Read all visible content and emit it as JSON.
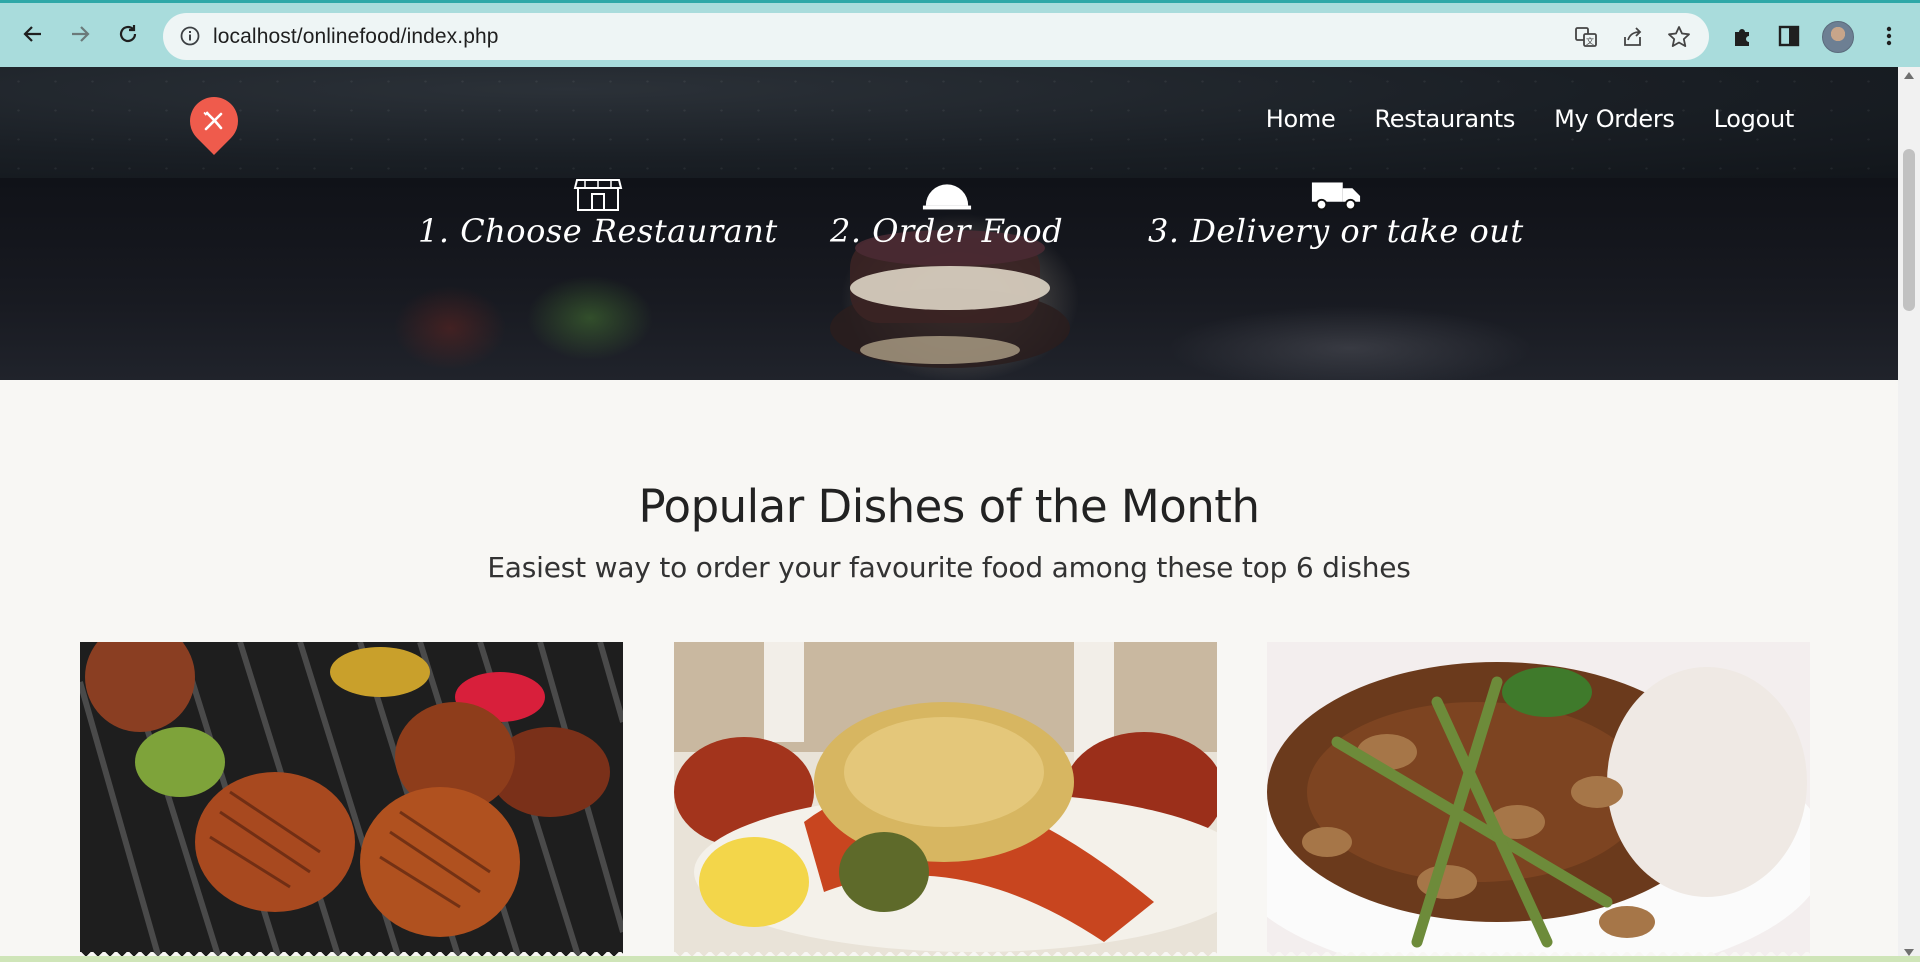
{
  "browser": {
    "url": "localhost/onlinefood/index.php",
    "icons": [
      "back-icon",
      "forward-icon",
      "reload-icon",
      "info-icon",
      "translate-icon",
      "share-icon",
      "star-icon",
      "extensions-icon",
      "sidepanel-icon",
      "profile-avatar",
      "menu-kebab-icon"
    ]
  },
  "header": {
    "logo_icon": "fork-knife-icon",
    "menu": [
      "Home",
      "Restaurants",
      "My Orders",
      "Logout"
    ]
  },
  "steps": [
    {
      "icon": "storefront-icon",
      "label": "1. Choose Restaurant"
    },
    {
      "icon": "cloche-icon",
      "label": "2. Order Food"
    },
    {
      "icon": "delivery-truck-icon",
      "label": "3. Delivery or take out"
    }
  ],
  "popular": {
    "title": "Popular Dishes of the Month",
    "subtitle": "Easiest way to order your favourite food among these top 6 dishes"
  },
  "colors": {
    "chrome_bg": "#a9dcdc",
    "brand_red": "#ef5b4c",
    "header_bg": "#1a1f25",
    "page_bg": "#f8f7f4"
  }
}
